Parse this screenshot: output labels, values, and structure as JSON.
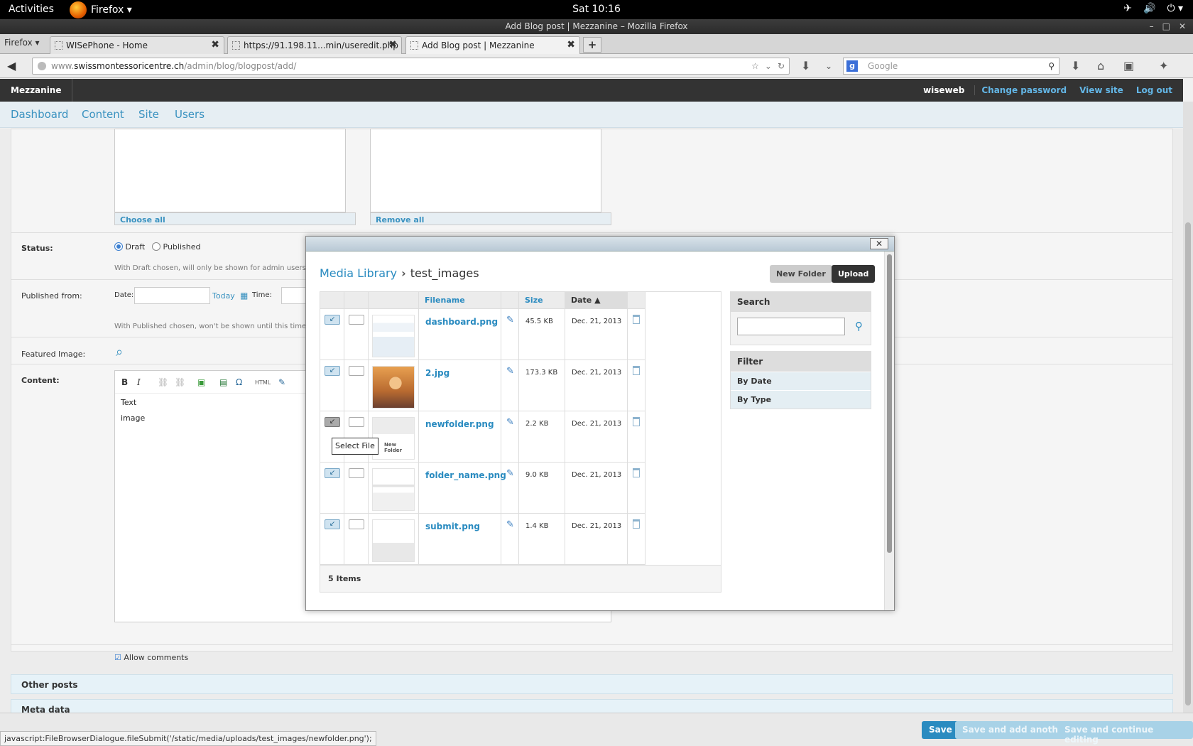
{
  "desktop": {
    "activities": "Activities",
    "app_menu": "Firefox ▾",
    "clock": "Sat 10:16"
  },
  "window": {
    "title": "Add Blog post | Mezzanine – Mozilla Firefox"
  },
  "browser": {
    "firefox_button": "Firefox",
    "tabs": [
      {
        "label": "WISePhone - Home"
      },
      {
        "label": "https://91.198.11...min/useredit.php"
      },
      {
        "label": "Add Blog post | Mezzanine"
      }
    ],
    "url_prefix": "www.",
    "url_host": "swissmontessoricentre.ch",
    "url_path": "/admin/blog/blogpost/add/",
    "search_placeholder": "Google"
  },
  "admin": {
    "brand": "Mezzanine",
    "user": "wiseweb",
    "links": [
      "Change password",
      "View site",
      "Log out"
    ],
    "menu": [
      "Dashboard",
      "Content",
      "Site",
      "Users"
    ]
  },
  "form": {
    "choose_all": "Choose all",
    "remove_all": "Remove all",
    "status_label": "Status:",
    "status_options": [
      "Draft",
      "Published"
    ],
    "status_help": "With Draft chosen, will only be shown for admin users on",
    "published_from_label": "Published from:",
    "date_label": "Date:",
    "today_link": "Today",
    "time_label": "Time:",
    "published_help": "With Published chosen, won't be shown until this time",
    "featured_image_label": "Featured Image:",
    "content_label": "Content:",
    "content_lines": [
      "Text",
      "image"
    ],
    "allow_comments": "Allow comments",
    "other_posts": "Other posts",
    "meta_data": "Meta data"
  },
  "footer": {
    "status_url": "javascript:FileBrowserDialogue.fileSubmit('/static/media/uploads/test_images/newfolder.png');",
    "save": "Save",
    "save_add": "Save and add another",
    "save_continue": "Save and continue editing"
  },
  "media_library": {
    "breadcrumb_root": "Media Library",
    "breadcrumb_sep": "›",
    "breadcrumb_current": "test_images",
    "new_folder": "New Folder",
    "upload": "Upload",
    "columns": {
      "filename": "Filename",
      "size": "Size",
      "date": "Date ▲"
    },
    "files": [
      {
        "name": "dashboard.png",
        "size": "45.5 KB",
        "date": "Dec. 21, 2013"
      },
      {
        "name": "2.jpg",
        "size": "173.3 KB",
        "date": "Dec. 21, 2013"
      },
      {
        "name": "newfolder.png",
        "size": "2.2 KB",
        "date": "Dec. 21, 2013"
      },
      {
        "name": "folder_name.png",
        "size": "9.0 KB",
        "date": "Dec. 21, 2013"
      },
      {
        "name": "submit.png",
        "size": "1.4 KB",
        "date": "Dec. 21, 2013"
      }
    ],
    "item_count": "5 Items",
    "tooltip": "Select File",
    "thumb_newfolder_text": "New Folder",
    "search_title": "Search",
    "filter_title": "Filter",
    "filters": [
      "By Date",
      "By Type"
    ]
  }
}
